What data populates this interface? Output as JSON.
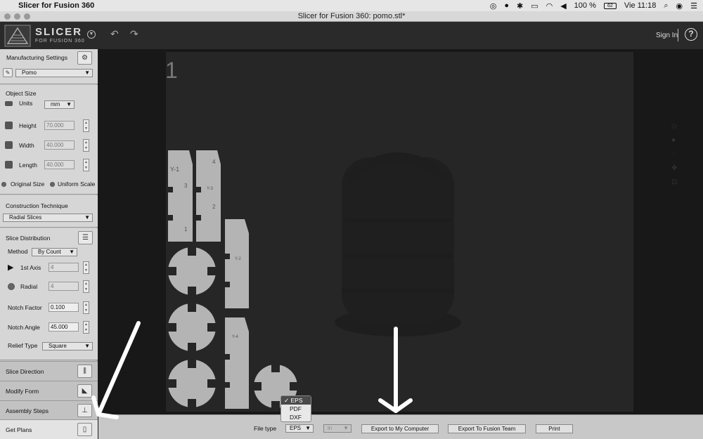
{
  "menubar": {
    "app_name": "Slicer for Fusion 360",
    "battery": "100 %",
    "battery_icon_text": "62",
    "clock": "Vie 11:18"
  },
  "window": {
    "title": "Slicer for Fusion 360: pomo.stl*"
  },
  "header": {
    "logo_title": "SLICER",
    "logo_subtitle": "FOR FUSION 360",
    "sign_in": "Sign In",
    "help": "?"
  },
  "sidebar": {
    "manufacturing_settings": "Manufacturing Settings",
    "material": "Pomo",
    "object_size": "Object Size",
    "units_label": "Units",
    "units_value": "mm",
    "height_label": "Height",
    "height_value": "70.000",
    "width_label": "Width",
    "width_value": "40.000",
    "length_label": "Length",
    "length_value": "40.000",
    "original_size": "Original Size",
    "uniform_scale": "Uniform Scale",
    "construction_technique": "Construction Technique",
    "technique_value": "Radial Slices",
    "slice_distribution": "Slice Distribution",
    "method_label": "Method",
    "method_value": "By Count",
    "axis1_label": "1st Axis",
    "axis1_value": "4",
    "radial_label": "Radial",
    "radial_value": "4",
    "notch_factor_label": "Notch Factor",
    "notch_factor_value": "0.100",
    "notch_angle_label": "Notch Angle",
    "notch_angle_value": "45.000",
    "relief_type_label": "Relief Type",
    "relief_type_value": "Square",
    "nav": {
      "slice_direction": "Slice Direction",
      "modify_form": "Modify Form",
      "assembly_steps": "Assembly Steps",
      "get_plans": "Get Plans"
    }
  },
  "canvas": {
    "page_number": "1",
    "part_labels": [
      "Y-1",
      "Y-3",
      "Y-2",
      "Y-4"
    ],
    "notch_numbers": [
      "4",
      "3",
      "2",
      "1"
    ]
  },
  "bottombar": {
    "file_type_label": "File type",
    "file_type_value": "EPS",
    "unit_value": "in",
    "export_computer": "Export to My Computer",
    "export_team": "Export To Fusion Team",
    "print": "Print"
  },
  "file_type_popup": {
    "options": [
      "EPS",
      "PDF",
      "DXF"
    ],
    "selected_mark": "✓"
  },
  "colors": {
    "panel": "#c9c9c9",
    "canvas": "#262626",
    "part": "#b8b8b8",
    "accent_white": "#ffffff"
  }
}
